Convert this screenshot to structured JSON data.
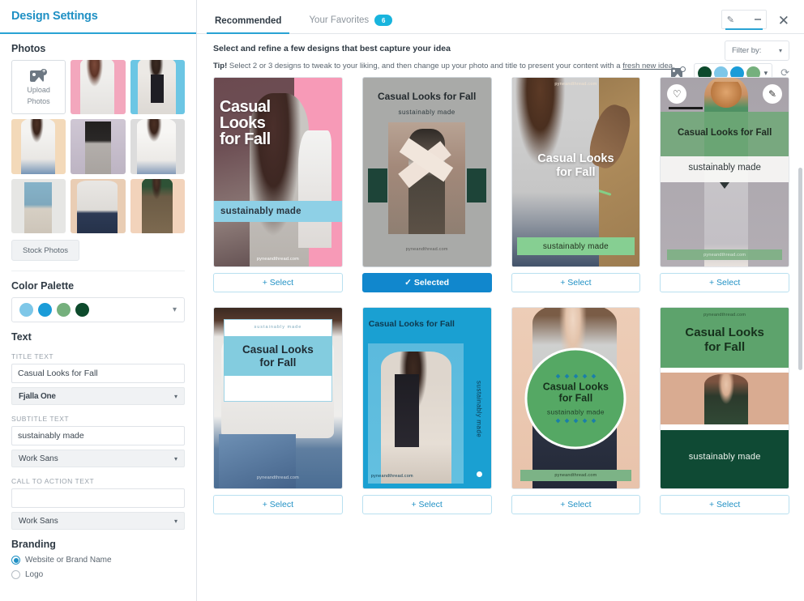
{
  "sidebar": {
    "title": "Design Settings",
    "photos": {
      "heading": "Photos",
      "upload_line1": "Upload",
      "upload_line2": "Photos",
      "upload_icon": "image-plus-icon",
      "stock_button": "Stock Photos"
    },
    "color_palette": {
      "heading": "Color Palette",
      "swatches": [
        "#7ec7e8",
        "#1a9cd8",
        "#75b07d",
        "#0d4a2c"
      ],
      "chevron": "chevron-down-icon"
    },
    "text": {
      "heading": "Text",
      "title_label": "TITLE TEXT",
      "title_value": "Casual Looks for Fall",
      "title_font": "Fjalla One",
      "subtitle_label": "SUBTITLE TEXT",
      "subtitle_value": "sustainably made",
      "subtitle_font": "Work Sans",
      "cta_label": "CALL TO ACTION TEXT",
      "cta_value": "",
      "cta_font": "Work Sans"
    },
    "branding": {
      "heading": "Branding",
      "option_website": "Website or Brand Name",
      "option_logo": "Logo",
      "selected": "Website or Brand Name"
    }
  },
  "header": {
    "tabs": [
      {
        "label": "Recommended",
        "active": true
      },
      {
        "label": "Your Favorites",
        "active": false,
        "badge": "6"
      }
    ],
    "edit_tab_icon": "pencil-icon",
    "close_icon": "close-icon"
  },
  "instructions": {
    "title": "Select and refine a few designs that best capture your idea",
    "tip_bold": "Tip!",
    "tip_text": " Select 2 or 3 designs to tweak to your liking, and then change up your photo and title to present your content with a ",
    "tip_link": "fresh new idea",
    "tip_end": ".",
    "filter_label": "Filter by:",
    "filter_chevron": "chevron-down-icon"
  },
  "toolbar": {
    "image_icon": "image-plus-icon",
    "palette_swatches": [
      "#0d4a2c",
      "#7ec7e8",
      "#1a9cd8",
      "#75b07d"
    ],
    "palette_chevron": "chevron-down-icon",
    "refresh_icon": "refresh-icon"
  },
  "buttons": {
    "select": "+ Select",
    "selected": "✓ Selected"
  },
  "brand_url": "pyneandthread.com",
  "designs": [
    {
      "id": "design-1",
      "title": "Casual Looks for Fall",
      "subtitle": "sustainably made",
      "url": "pyneandthread.com",
      "button": "+ Select",
      "selected": false
    },
    {
      "id": "design-2",
      "title": "Casual Looks for Fall",
      "subtitle": "sustainably made",
      "url": "pyneandthread.com",
      "button": "✓ Selected",
      "selected": true
    },
    {
      "id": "design-3",
      "title": "Casual Looks for Fall",
      "subtitle": "sustainably made",
      "url": "pyneandthread.com",
      "button": "+ Select",
      "selected": false
    },
    {
      "id": "design-4",
      "title": "Casual Looks for Fall",
      "subtitle": "sustainably made",
      "url": "pyneandthread.com",
      "button": "+ Select",
      "selected": false,
      "hover": true,
      "favorite_icon": "heart-icon",
      "edit_icon": "pencil-icon"
    },
    {
      "id": "design-5",
      "title": "Casual Looks for Fall",
      "subtitle": "sustainably made",
      "url": "pyneandthread.com",
      "button": "+ Select",
      "selected": false
    },
    {
      "id": "design-6",
      "title": "Casual Looks for Fall",
      "subtitle": "sustainably made",
      "url": "pyneandthread.com",
      "button": "+ Select",
      "selected": false
    },
    {
      "id": "design-7",
      "title": "Casual Looks for Fall",
      "subtitle": "sustainably made",
      "url": "pyneandthread.com",
      "button": "+ Select",
      "selected": false
    },
    {
      "id": "design-8",
      "title": "Casual Looks for Fall",
      "subtitle": "sustainably made",
      "url": "pyneandthread.com",
      "button": "+ Select",
      "selected": false
    }
  ]
}
